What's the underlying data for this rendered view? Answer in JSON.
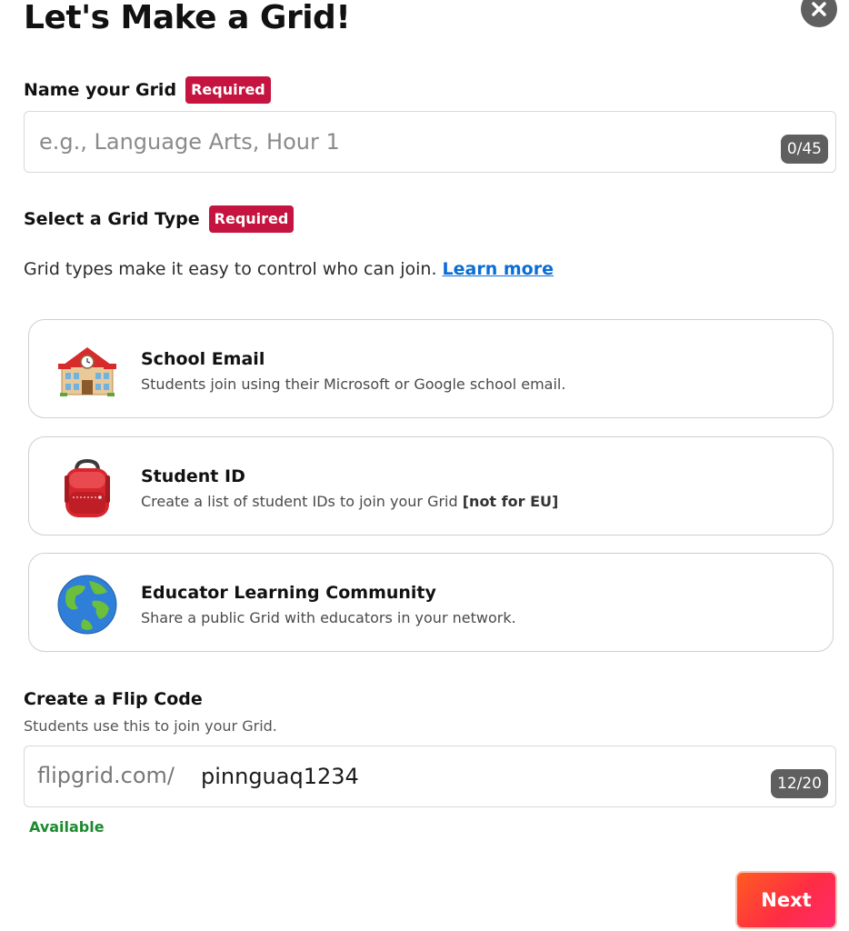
{
  "header": {
    "title": "Let's Make a Grid!",
    "close_icon": "close-icon"
  },
  "name_section": {
    "label": "Name your Grid",
    "required": "Required",
    "placeholder": "e.g., Language Arts, Hour 1",
    "value": "",
    "counter": "0/45"
  },
  "type_section": {
    "label": "Select a Grid Type",
    "required": "Required",
    "helper": "Grid types make it easy to control who can join.",
    "learn_more": "Learn more",
    "options": [
      {
        "title": "School Email",
        "description": "Students join using their Microsoft or Google school email.",
        "icon": "school-building-icon"
      },
      {
        "title": "Student ID",
        "description": "Create a list of student IDs to join your Grid",
        "description_strong": "[not for EU]",
        "icon": "backpack-icon"
      },
      {
        "title": "Educator Learning Community",
        "description": "Share a public Grid with educators in your network.",
        "icon": "globe-icon"
      }
    ]
  },
  "flip_code": {
    "label": "Create a Flip Code",
    "subtitle": "Students use this to join your Grid.",
    "prefix": "flipgrid.com/",
    "value": "pinnguaq1234",
    "counter": "12/20",
    "status": "Available"
  },
  "footer": {
    "next_label": "Next"
  },
  "colors": {
    "required_badge": "#c4143f",
    "link": "#0a6dd6",
    "available": "#1d8a2f",
    "counter_bg": "#5f5f5f",
    "next_gradient_start": "#ff5c1f",
    "next_gradient_end": "#ff2a6a"
  }
}
